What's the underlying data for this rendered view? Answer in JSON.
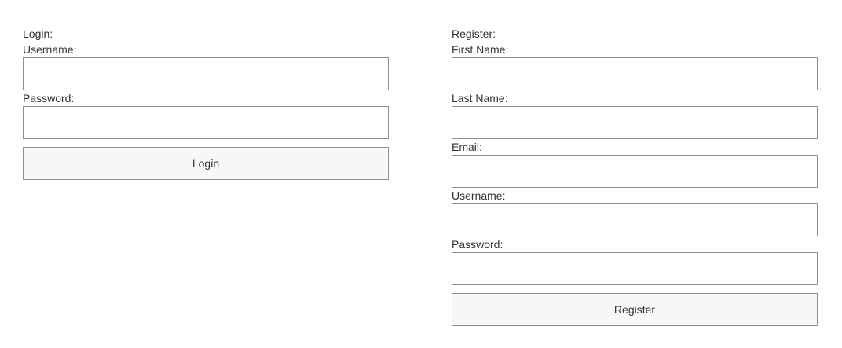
{
  "login": {
    "title": "Login:",
    "fields": [
      {
        "label": "Username:",
        "value": "",
        "placeholder": ""
      },
      {
        "label": "Password:",
        "value": "",
        "placeholder": ""
      }
    ],
    "submit_label": "Login"
  },
  "register": {
    "title": "Register:",
    "fields": [
      {
        "label": "First Name:",
        "value": "",
        "placeholder": ""
      },
      {
        "label": "Last Name:",
        "value": "",
        "placeholder": ""
      },
      {
        "label": "Email:",
        "value": "",
        "placeholder": ""
      },
      {
        "label": "Username:",
        "value": "",
        "placeholder": ""
      },
      {
        "label": "Password:",
        "value": "",
        "placeholder": ""
      }
    ],
    "submit_label": "Register"
  }
}
